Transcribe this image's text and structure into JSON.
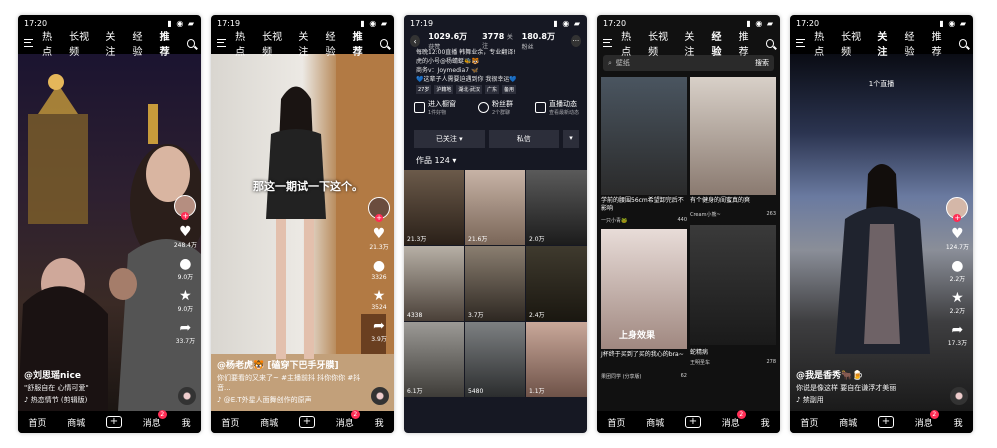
{
  "phones": [
    {
      "status": {
        "time": "17:20",
        "icons": "▮ ◉ ▰"
      },
      "nav": {
        "tabs": [
          "热点",
          "长视频",
          "关注",
          "经验",
          "推荐"
        ],
        "active": "推荐"
      },
      "side": {
        "likes": "248.4万",
        "comments": "9.0万",
        "stars": "9.0万",
        "shares": "33.7万"
      },
      "caption": {
        "author": "@刘思瑶nice",
        "text": "\"舒服自在 心情可爱\"",
        "tag": "♪ 热恋情节 (剪辑版)"
      },
      "bottom": {
        "items": [
          "首页",
          "商城",
          "+",
          "消息",
          "我"
        ],
        "msg_count": "2"
      }
    },
    {
      "status": {
        "time": "17:19",
        "icons": "▮ ◉ ▰"
      },
      "nav": {
        "tabs": [
          "热点",
          "长视频",
          "关注",
          "经验",
          "推荐"
        ],
        "active": "推荐"
      },
      "overlay_text": "那这一期试一下这个。",
      "side": {
        "likes": "21.3万",
        "comments": "3326",
        "stars": "3524",
        "shares": "3.9万"
      },
      "caption": {
        "author": "@杨老虎🐯 [磕穿下巴手牙膜]",
        "text": "你们要看的又来了~ #主播前抖 抖你你你 #抖音...",
        "tag": "♪ @E.T外星人面舞创作的原声"
      },
      "bottom": {
        "items": [
          "首页",
          "商城",
          "+",
          "消息",
          "我"
        ],
        "msg_count": "2"
      }
    },
    {
      "status": {
        "time": "17:19",
        "icons": "▮ ◉ ▰"
      },
      "profile": {
        "stats": [
          {
            "num": "1029.6万",
            "label": "获赞"
          },
          {
            "num": "3778",
            "label": "关注"
          },
          {
            "num": "180.8万",
            "label": "粉丝"
          }
        ],
        "bio": [
          "每晚12:00直播 韩舞业余，专业翻译!",
          "虎的小号@杨蜻蜓🐝🐯",
          "商务v：Joymedia7 🦋",
          "💙这辈子人需要迫遇到你 我很幸运💙"
        ],
        "tags": [
          "27岁",
          "沪籍地",
          "湖北·武汉",
          "广东",
          "备用"
        ],
        "actions": [
          {
            "title": "进入橱窗",
            "sub": "1件好物"
          },
          {
            "title": "粉丝群",
            "sub": "2个群聊"
          },
          {
            "title": "直播动态",
            "sub": "查看最新动态"
          }
        ],
        "follow_label": "已关注 ▾",
        "message_label": "私信",
        "works_label": "作品 124 ▾",
        "thumbs": [
          "21.3万",
          "21.6万",
          "2.0万",
          "4338",
          "3.7万",
          "2.4万",
          "6.1万",
          "5480",
          "1.1万"
        ]
      }
    },
    {
      "status": {
        "time": "17:20",
        "icons": "▮ ◉ ▰"
      },
      "nav": {
        "tabs": [
          "热点",
          "长视频",
          "关注",
          "经验",
          "推荐"
        ],
        "active": "经验"
      },
      "search_placeholder": "壁纸",
      "search_button": "搜索",
      "cards": [
        {
          "title": "学前的腰围56cm希望卸完后不影响",
          "user": "一只小青🐸",
          "likes": "440"
        },
        {
          "title": "有个健身的闺蜜真的爽",
          "user": "Cream小熊~",
          "likes": "263"
        },
        {
          "title": "J杯终于买到了买的我心的bra~",
          "user": "果团同学 (分享版)",
          "likes": "62"
        },
        {
          "title": "蛇精病",
          "user": "王明圣车",
          "likes": "278"
        }
      ],
      "card_overlay": "上身效果",
      "bottom": {
        "items": [
          "首页",
          "商城",
          "+",
          "消息",
          "我"
        ],
        "msg_count": "2"
      }
    },
    {
      "status": {
        "time": "17:20",
        "icons": "▮ ◉ ▰"
      },
      "nav": {
        "tabs": [
          "热点",
          "长视频",
          "关注",
          "经验",
          "推荐"
        ],
        "active": "关注"
      },
      "live_label": "1个直播",
      "side": {
        "likes": "124.7万",
        "comments": "2.2万",
        "stars": "2.2万",
        "shares": "17.3万"
      },
      "caption": {
        "author": "@我是香秀🐂🍺",
        "text": "你说是像这样 要自在谦浮才美丽",
        "tag": "♪ 禁副用"
      },
      "bottom": {
        "items": [
          "首页",
          "商城",
          "+",
          "消息",
          "我"
        ],
        "msg_count": "2"
      }
    }
  ]
}
